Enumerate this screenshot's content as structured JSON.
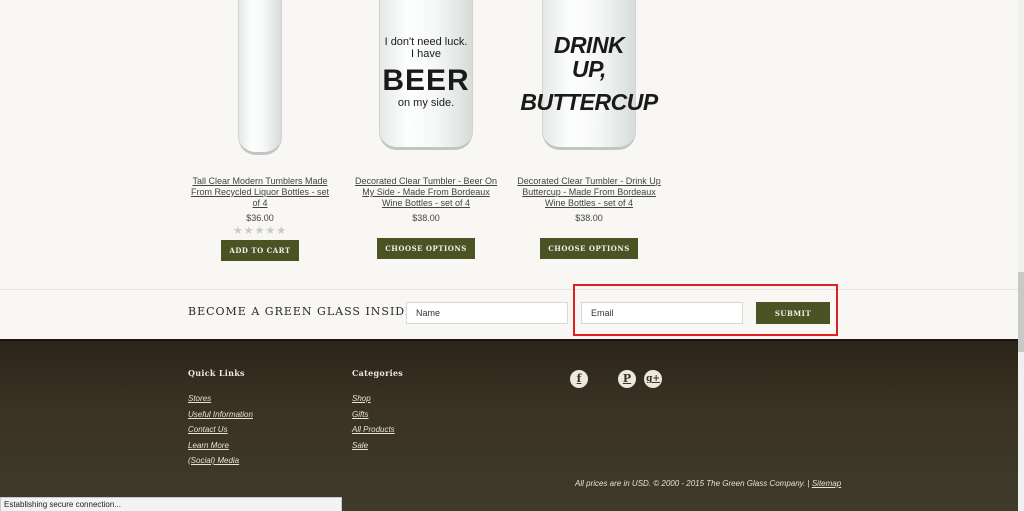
{
  "products": [
    {
      "title": "Tall Clear Modern Tumblers Made From Recycled Liquor Bottles - set of 4",
      "price": "$36.00",
      "stars": "★★★★★",
      "button": "ADD TO CART"
    },
    {
      "title": "Decorated Clear Tumbler - Beer On My Side - Made From Bordeaux Wine Bottles - set of 4",
      "price": "$38.00",
      "button": "CHOOSE OPTIONS",
      "glass_text": {
        "top": "I don't need luck.\nI have",
        "big": "BEER",
        "bottom": "on my side."
      }
    },
    {
      "title": "Decorated Clear Tumbler - Drink Up Buttercup - Made From Bordeaux Wine Bottles - set of 4",
      "price": "$38.00",
      "button": "CHOOSE OPTIONS",
      "glass_text": {
        "line1": "DRINK UP,",
        "line2": "BUTTERCUP"
      }
    }
  ],
  "newsletter": {
    "title": "BECOME A GREEN GLASS INSIDER",
    "name_placeholder": "Name",
    "email_placeholder": "Email",
    "submit_label": "SUBMIT"
  },
  "footer": {
    "quick_links_heading": "Quick Links",
    "quick_links": [
      "Stores",
      "Useful Information",
      "Contact Us",
      "Learn More",
      "(Social) Media"
    ],
    "categories_heading": "Categories",
    "categories": [
      "Shop",
      "Gifts",
      "All Products",
      "Sale"
    ],
    "social_icons": [
      {
        "icon": "facebook-icon",
        "glyph": "f"
      },
      {
        "icon": "pinterest-icon",
        "glyph": "P"
      },
      {
        "icon": "google-plus-icon",
        "glyph": "g+"
      }
    ],
    "copyright": "All prices are in USD. © 2000 - 2015 The Green Glass Company. | ",
    "sitemap_label": "Sitemap"
  },
  "status_bar": "Establishing secure connection...",
  "colors": {
    "button_green": "#4b5224",
    "footer_bg": "#3a3325",
    "highlight": "#e02020"
  }
}
